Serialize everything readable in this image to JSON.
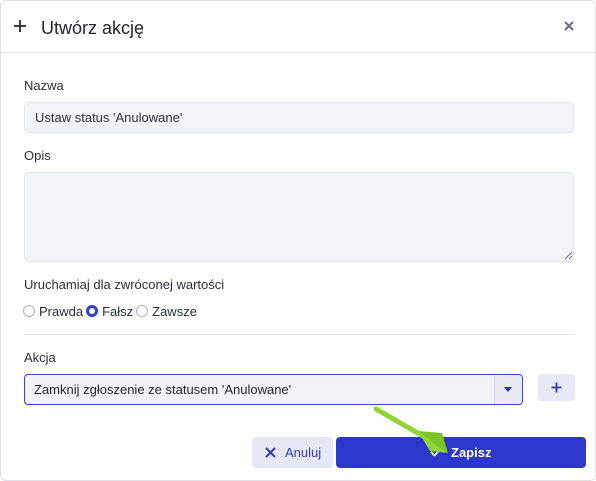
{
  "dialog": {
    "title": "Utwórz akcję",
    "close_icon": "close-icon",
    "header_icon": "plus-icon"
  },
  "form": {
    "name_label": "Nazwa",
    "name_value": "Ustaw status 'Anulowane'",
    "description_label": "Opis",
    "description_value": "",
    "trigger_label": "Uruchamiaj dla zwróconej wartości",
    "trigger_options": [
      {
        "label": "Prawda",
        "checked": false
      },
      {
        "label": "Fałsz",
        "checked": true
      },
      {
        "label": "Zawsze",
        "checked": false
      }
    ],
    "action_label": "Akcja",
    "action_selected": "Zamknij zgłoszenie ze statusem 'Anulowane'"
  },
  "footer": {
    "cancel_label": "Anuluj",
    "save_label": "Zapisz"
  },
  "colors": {
    "primary": "#2c37cc",
    "secondary_bg": "#e6e8f7",
    "annotation_arrow": "#7ed321"
  }
}
